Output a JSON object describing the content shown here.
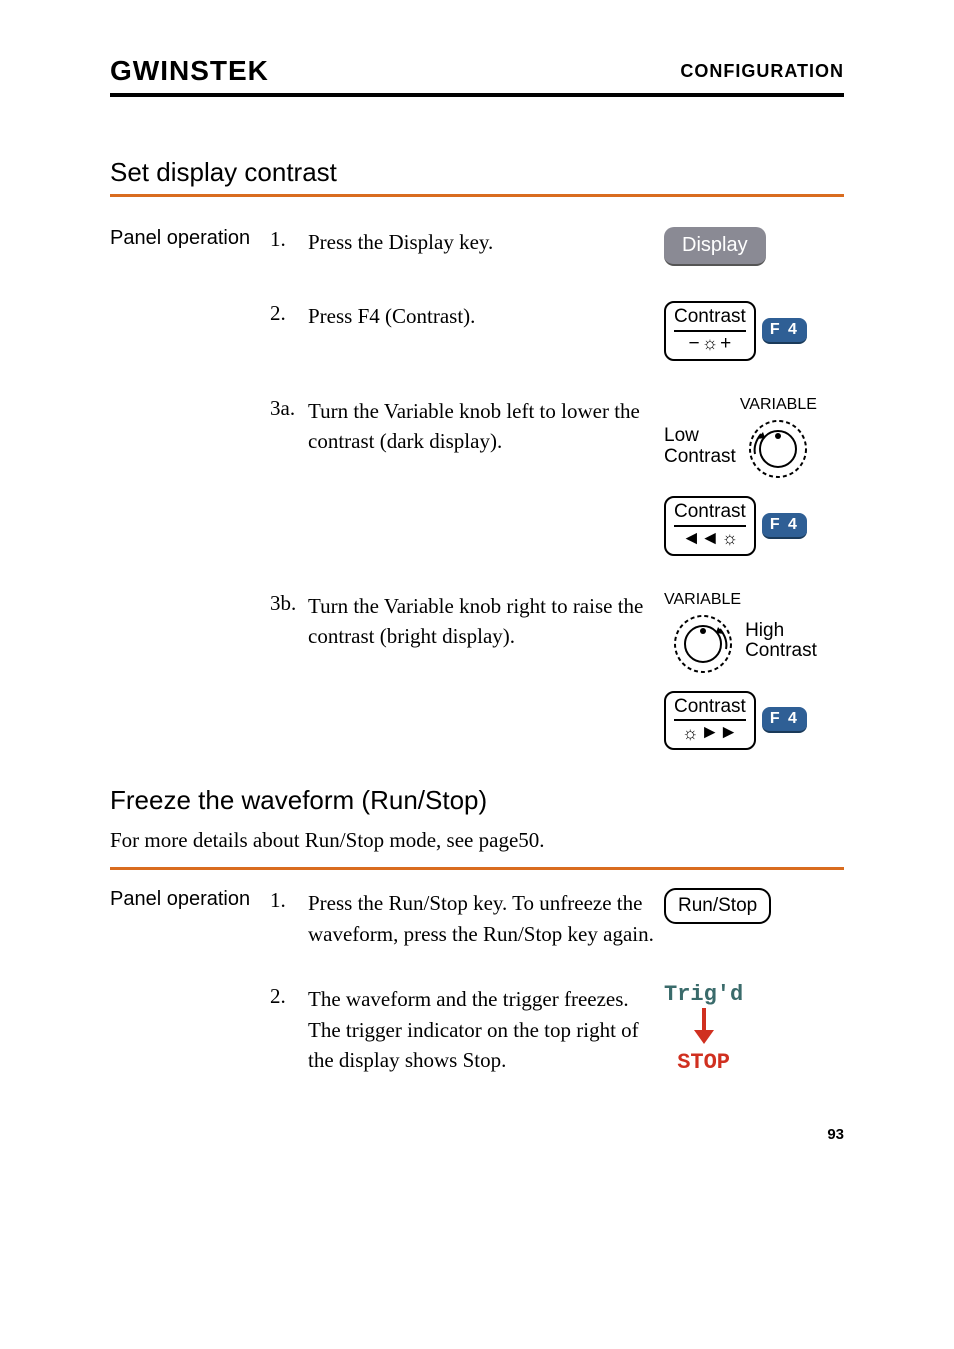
{
  "header": {
    "logo": "GWINSTEK",
    "config": "CONFIGURATION"
  },
  "section1": {
    "title": "Set display contrast",
    "panel_op": "Panel operation",
    "steps": {
      "s1": {
        "num": "1.",
        "text": "Press the Display key."
      },
      "s2": {
        "num": "2.",
        "text": "Press F4 (Contrast)."
      },
      "s3a": {
        "num": "3a.",
        "text": "Turn the Variable knob left to lower the contrast (dark display)."
      },
      "s3b": {
        "num": "3b.",
        "text": "Turn the Variable knob right to raise the contrast (bright display)."
      }
    },
    "graphics": {
      "display_key": "Display",
      "contrast_label": "Contrast",
      "f4": "F 4",
      "variable": "VARIABLE",
      "low": "Low",
      "low2": "Contrast",
      "high": "High",
      "high2": "Contrast"
    }
  },
  "section2": {
    "title": "Freeze the waveform (Run/Stop)",
    "subtext": "For more details about Run/Stop mode, see page50.",
    "panel_op": "Panel operation",
    "steps": {
      "s1": {
        "num": "1.",
        "text": "Press the Run/Stop key. To unfreeze the waveform, press the Run/Stop key again."
      },
      "s2": {
        "num": "2.",
        "text": "The waveform and the trigger freezes. The trigger indicator on the top right of the display shows Stop."
      }
    },
    "graphics": {
      "runstop": "Run/Stop",
      "trigd": "Trig'd",
      "stop": "STOP"
    }
  },
  "footer": {
    "page": "93"
  }
}
